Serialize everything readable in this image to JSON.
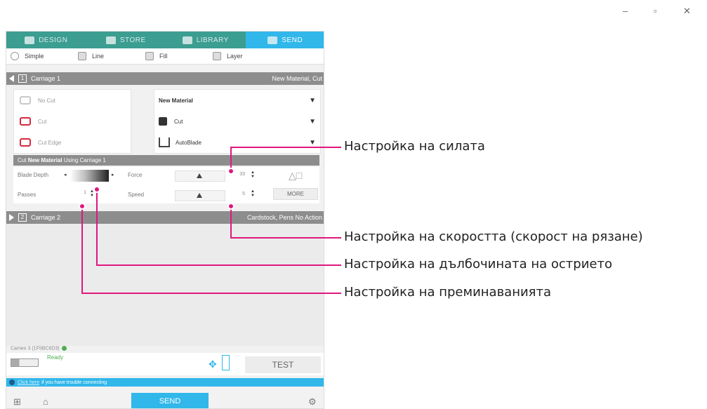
{
  "window": {
    "minimize": "–",
    "maximize": "▫",
    "close": "✕"
  },
  "tabs": [
    {
      "label": "DESIGN"
    },
    {
      "label": "STORE"
    },
    {
      "label": "LIBRARY"
    },
    {
      "label": "SEND"
    }
  ],
  "modes": [
    {
      "label": "Simple"
    },
    {
      "label": "Line"
    },
    {
      "label": "Fill"
    },
    {
      "label": "Layer"
    }
  ],
  "carriage1": {
    "number": "1",
    "label": "Carriage 1",
    "material_right": "New Material, Cut"
  },
  "cut_options": [
    {
      "label": "No Cut"
    },
    {
      "label": "Cut"
    },
    {
      "label": "Cut Edge"
    }
  ],
  "material": {
    "name": "New Material",
    "action": "Cut",
    "blade": "AutoBlade",
    "dropdown": "▼"
  },
  "params_header": {
    "prefix": "Cut",
    "material": "New Material",
    "suffix": "Using Carriage 1"
  },
  "params": {
    "blade_depth_label": "Blade Depth",
    "passes_label": "Passes",
    "passes_value": "1",
    "force_label": "Force",
    "force_value": "33",
    "speed_label": "Speed",
    "speed_value": "5",
    "more_label": "MORE"
  },
  "carriage2": {
    "number": "2",
    "label": "Carriage 2",
    "status_right": "Cardstock, Pens No Action"
  },
  "status": {
    "device": "Cameo 3 (1F5BC6D3)"
  },
  "device": {
    "state": "Ready",
    "test_label": "TEST"
  },
  "info": {
    "link": "Click here",
    "text": "if you have trouble connecting"
  },
  "footer": {
    "send_label": "SEND"
  },
  "callouts": [
    {
      "text": "Настройка на силата"
    },
    {
      "text": "Настройка на скоростта (скорост на рязане)"
    },
    {
      "text": "Настройка на дълбочината на острието"
    },
    {
      "text": "Настройка на преминаванията"
    }
  ],
  "colors": {
    "accent": "#31b7ea",
    "tab_bar": "#3c9d91",
    "callout": "#e0177e",
    "cut_red": "#d9293d"
  }
}
